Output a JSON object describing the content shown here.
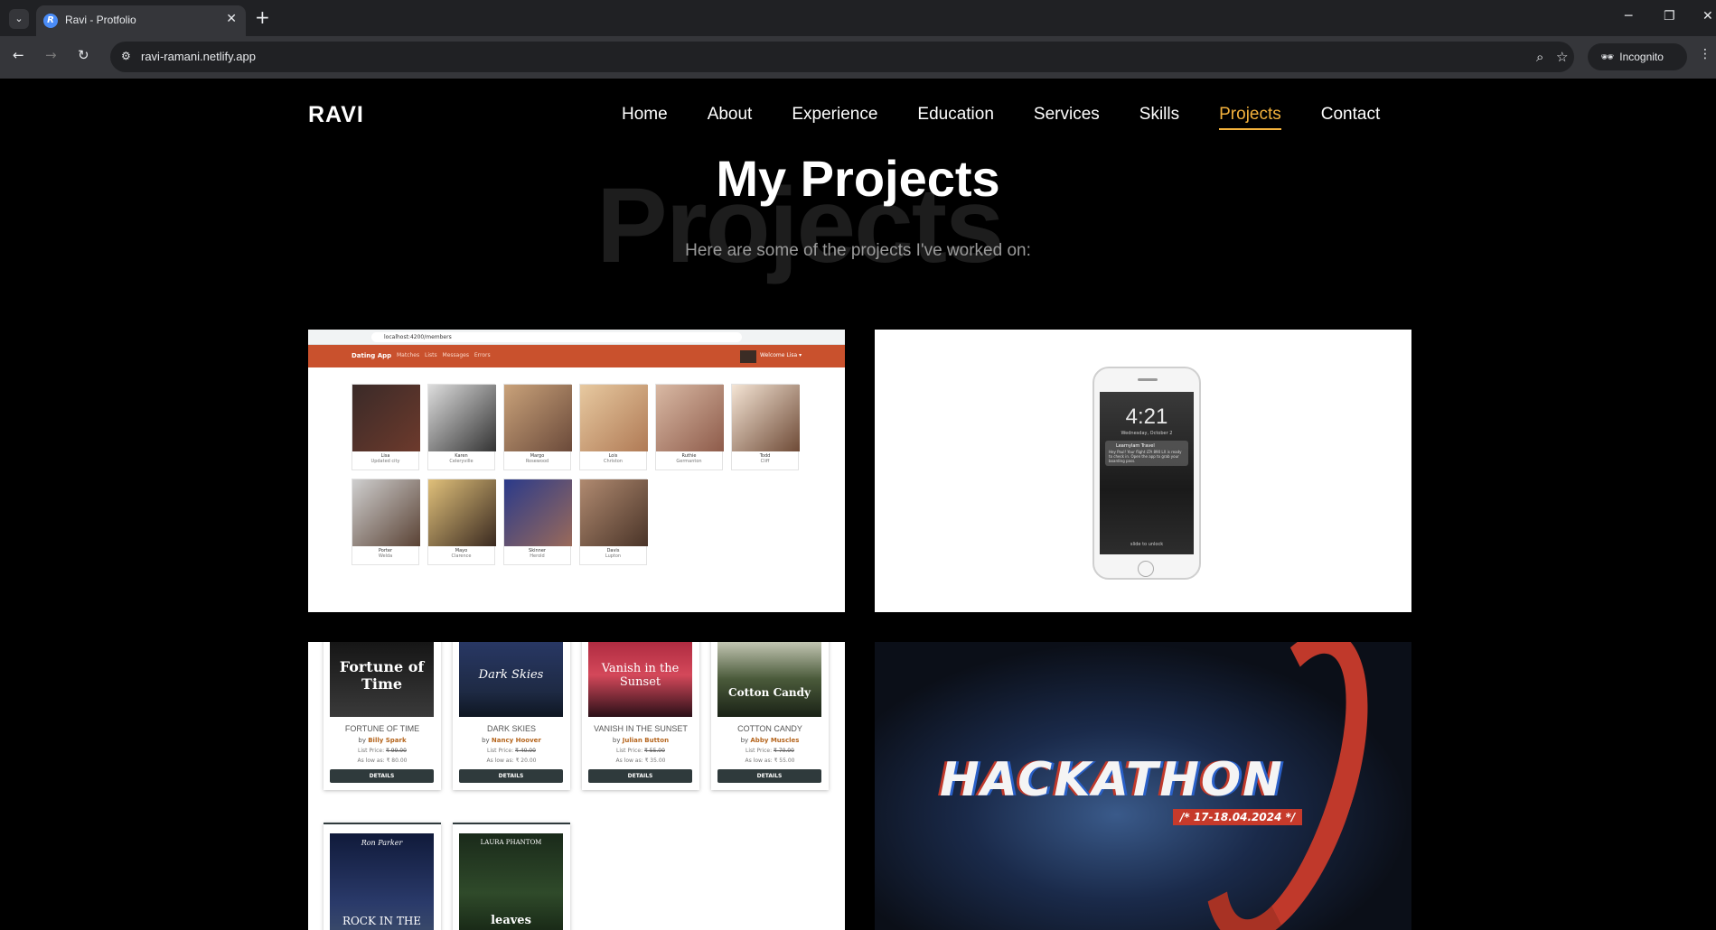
{
  "browser": {
    "tab_title": "Ravi - Protfolio",
    "favicon_letter": "R",
    "url": "ravi-ramani.netlify.app",
    "incognito_label": "Incognito"
  },
  "site": {
    "logo": "RAVI",
    "nav": [
      "Home",
      "About",
      "Experience",
      "Education",
      "Services",
      "Skills",
      "Projects",
      "Contact"
    ],
    "active_nav": "Projects"
  },
  "section": {
    "bg_word": "Projects",
    "title": "My Projects",
    "subtitle": "Here are some of the projects I've worked on:"
  },
  "project_dating": {
    "url": "localhost:4200/members",
    "brand": "Dating App",
    "links": "Matches Lists Messages Errors",
    "welcome": "Welcome Lisa ▾",
    "members": [
      {
        "name": "Lisa",
        "city": "Updated city"
      },
      {
        "name": "Karen",
        "city": "Celeryville"
      },
      {
        "name": "Margo",
        "city": "Rosewood"
      },
      {
        "name": "Lois",
        "city": "Christon"
      },
      {
        "name": "Ruthie",
        "city": "Germanton"
      },
      {
        "name": "Todd",
        "city": "Cliff"
      },
      {
        "name": "Porter",
        "city": "Welda"
      },
      {
        "name": "Mayo",
        "city": "Clarence"
      },
      {
        "name": "Skinner",
        "city": "Herold"
      },
      {
        "name": "Davis",
        "city": "Lupton"
      }
    ]
  },
  "project_phone": {
    "time": "4:21",
    "date": "Wednesday, October 2",
    "notification_title": "Learnylam Travel",
    "notification_body": "Hey Paul! Your flight LTA 890 LX is ready to check in. Open the app to grab your boarding pass.",
    "unlock": "slide to unlock"
  },
  "project_books": {
    "books": [
      {
        "cover": "Fortune of Time",
        "title": "FORTUNE OF TIME",
        "author": "Billy Spark",
        "list_price": "₹ 99.00",
        "low_price": "₹ 80.00",
        "button": "DETAILS"
      },
      {
        "cover": "Dark Skies",
        "title": "DARK SKIES",
        "author": "Nancy Hoover",
        "list_price": "₹ 40.00",
        "low_price": "₹ 20.00",
        "button": "DETAILS"
      },
      {
        "cover": "Vanish in the Sunset",
        "title": "VANISH IN THE SUNSET",
        "author": "Julian Button",
        "list_price": "₹ 55.00",
        "low_price": "₹ 35.00",
        "button": "DETAILS"
      },
      {
        "cover": "Cotton Candy",
        "title": "COTTON CANDY",
        "author": "Abby Muscles",
        "list_price": "₹ 70.00",
        "low_price": "₹ 55.00",
        "button": "DETAILS"
      },
      {
        "cover_author": "Ron Parker",
        "cover": "ROCK IN THE"
      },
      {
        "cover_author": "LAURA PHANTOM",
        "cover": "leaves"
      }
    ],
    "list_label": "List Price:",
    "low_label": "As low as:",
    "by_label": "by"
  },
  "project_hackathon": {
    "title": "HACKATHON",
    "dates": "/* 17-18.04.2024 */"
  },
  "colors": {
    "accent": "#f3b13c",
    "dating_nav": "#c9512d",
    "hack_red": "#c63a2b"
  }
}
